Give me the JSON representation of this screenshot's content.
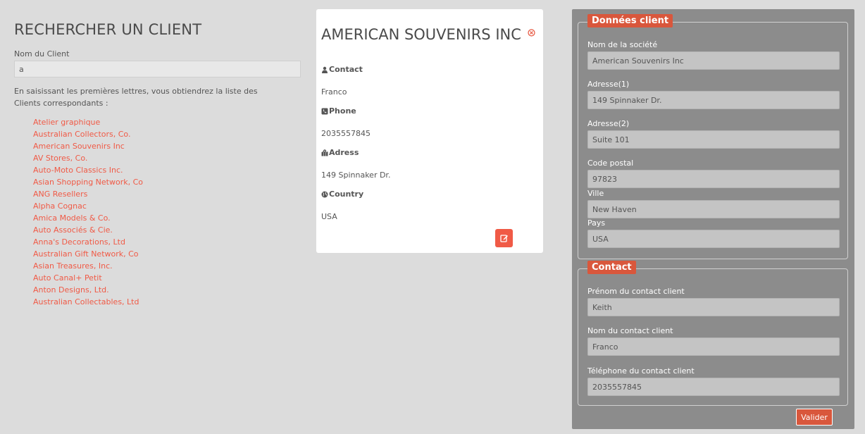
{
  "search": {
    "title": "RECHERCHER UN CLIENT",
    "label": "Nom du Client",
    "value": "a",
    "help": "En saisissant les premières lettres, vous obtiendrez la liste des Clients correspondants :",
    "results": [
      "Atelier graphique",
      "Australian Collectors, Co.",
      "American Souvenirs Inc",
      "AV Stores, Co.",
      "Auto-Moto Classics Inc.",
      "Asian Shopping Network, Co",
      "ANG Resellers",
      "Alpha Cognac",
      "Amica Models & Co.",
      "Auto Associés & Cie.",
      "Anna's Decorations, Ltd",
      "Australian Gift Network, Co",
      "Asian Treasures, Inc.",
      "Auto Canal+ Petit",
      "Anton Designs, Ltd.",
      "Australian Collectables, Ltd"
    ]
  },
  "card": {
    "title": "AMERICAN SOUVENIRS INC",
    "contact_label": "Contact",
    "contact_value": "Franco",
    "phone_label": "Phone",
    "phone_value": "2035557845",
    "address_label": "Adress",
    "address_value": "149 Spinnaker Dr.",
    "country_label": "Country",
    "country_value": "USA",
    "close_icon": "times-circle-icon",
    "edit_icon": "edit-icon"
  },
  "client_data": {
    "legend": "Données client",
    "company_label": "Nom de la société",
    "company_value": "American Souvenirs Inc",
    "address1_label": "Adresse(1)",
    "address1_value": "149 Spinnaker Dr.",
    "address2_label": "Adresse(2)",
    "address2_value": "Suite 101",
    "postal_label": "Code postal",
    "postal_value": "97823",
    "city_label": "Ville",
    "city_value": "New Haven",
    "country_label": "Pays",
    "country_value": "USA"
  },
  "contact": {
    "legend": "Contact",
    "firstname_label": "Prénom du contact client",
    "firstname_value": "Keith",
    "lastname_label": "Nom du contact client",
    "lastname_value": "Franco",
    "phone_label": "Téléphone du contact client",
    "phone_value": "2035557845"
  },
  "valider_label": "Valider",
  "colors": {
    "accent": "#f05a46",
    "legend": "#d9573c",
    "panel": "#8c8c8c",
    "background": "#dcdcdc"
  }
}
